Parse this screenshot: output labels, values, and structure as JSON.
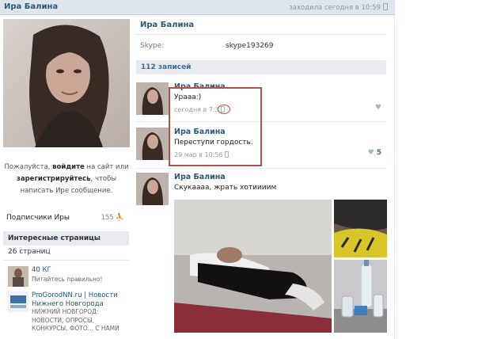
{
  "header": {
    "name": "Ира Балина",
    "status": "заходила сегодня в 10:59"
  },
  "sidebar": {
    "login_pre": "Пожалуйста,",
    "login_link1": "войдите",
    "login_mid": "на сайт или",
    "login_link2": "зарегистрируйтесь",
    "login_post": ", чтобы",
    "login_line3": "написать Ире сообщение.",
    "subscribers_label": "Подписчики Иры",
    "subscribers_count": "155",
    "interesting_title": "Интересные страницы",
    "interesting_count": "26 страниц",
    "pages": [
      {
        "title": "40 КГ",
        "subtitle": "Питайтесь правильно!"
      },
      {
        "title": "ProGorodNN.ru | Новости Нижнего Новгорода",
        "subtitle": "НИЖНИЙ НОВГОРОД: НОВОСТИ, ОПРОСЫ, КОНКУРСЫ, ФОТО... С НАМИ"
      }
    ]
  },
  "profile": {
    "name": "Ира Балина",
    "skype_label": "Skype:",
    "skype_value": "skype193269",
    "posts_count": "112 записей"
  },
  "posts": [
    {
      "author": "Ира Балина",
      "text": "Урааа:)",
      "date": "сегодня в 7:3",
      "likes": ""
    },
    {
      "author": "Ира Балина",
      "text": "Переступи гордость.",
      "date": "29 мар в 10:56",
      "likes": "5"
    },
    {
      "author": "Ира Балина",
      "text": "Скукаааа, жрать хотиииим",
      "date": "",
      "likes": ""
    }
  ],
  "colors": {
    "link": "#2b587a",
    "bar": "#e7ebf0",
    "highlight": "#b2514b"
  }
}
